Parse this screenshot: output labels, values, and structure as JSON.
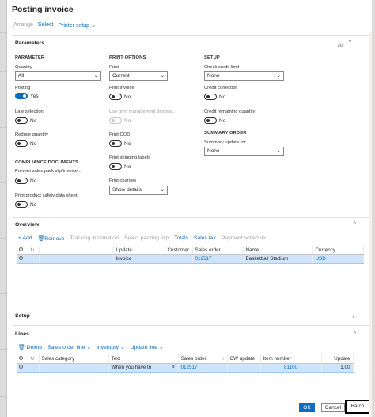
{
  "title": "Posting invoice",
  "toolbar": {
    "arrange": "Arrange",
    "select": "Select",
    "printer_setup": "Printer setup"
  },
  "parameters": {
    "heading": "Parameters",
    "all": "All",
    "parameter": {
      "heading": "PARAMETER",
      "quantity_label": "Quantity",
      "quantity_value": "All",
      "posting_label": "Posting",
      "posting_value": "Yes",
      "late_label": "Late selection",
      "late_value": "No",
      "reduce_label": "Reduce quantity",
      "reduce_value": "No"
    },
    "compliance": {
      "heading": "COMPLIANCE DOCUMENTS",
      "prevent_label": "Prevent sales pack slip/invoice...",
      "prevent_value": "No",
      "safety_label": "Print product safety data sheet",
      "safety_value": "No"
    },
    "print_options": {
      "heading": "PRINT OPTIONS",
      "print_label": "Print",
      "print_value": "Current",
      "print_invoice_label": "Print invoice",
      "print_invoice_value": "No",
      "use_mgmt_label": "Use print management destina...",
      "use_mgmt_value": "No",
      "print_cod_label": "Print COD",
      "print_cod_value": "No",
      "ship_labels_label": "Print shipping labels",
      "ship_labels_value": "No",
      "charges_label": "Print charges",
      "charges_value": "Show details"
    },
    "setup": {
      "heading": "SETUP",
      "credit_limit_label": "Check credit limit",
      "credit_limit_value": "None",
      "credit_corr_label": "Credit correction",
      "credit_corr_value": "No",
      "credit_rem_label": "Credit remaining quantity",
      "credit_rem_value": "No"
    },
    "summary": {
      "heading": "SUMMARY ORDER",
      "update_label": "Summary update for",
      "update_value": "None"
    }
  },
  "overview": {
    "heading": "Overview",
    "actions": {
      "add": "+ Add",
      "remove": "Remove",
      "tracking": "Tracking information",
      "select_slip": "Select packing slip",
      "totals": "Totals",
      "sales_tax": "Sales tax",
      "payment": "Payment schedule"
    },
    "columns": [
      "Update",
      "Customer ...",
      "Sales order",
      "Name",
      "Currency"
    ],
    "rows": [
      {
        "update": "Invoice",
        "customer": "",
        "sales_order": "012517",
        "name": "Basketball Stadium",
        "currency": "USD"
      }
    ]
  },
  "setup_section": {
    "heading": "Setup"
  },
  "lines": {
    "heading": "Lines",
    "actions": {
      "delete": "Delete",
      "sales_order_line": "Sales order line",
      "inventory": "Inventory",
      "update_line": "Update line"
    },
    "columns": [
      "Sales category",
      "Text",
      "Sales order",
      "CW update",
      "Item number",
      "Update"
    ],
    "rows": [
      {
        "category": "",
        "text": "When you have to",
        "sales_order": "012517",
        "cw_update": "",
        "item": "81100",
        "update": "1.00"
      }
    ]
  },
  "buttons": {
    "ok": "OK",
    "cancel": "Cancel",
    "batch": "Batch"
  },
  "colors": {
    "accent": "#0f6cbd",
    "selected_row": "#cfe4fa"
  }
}
